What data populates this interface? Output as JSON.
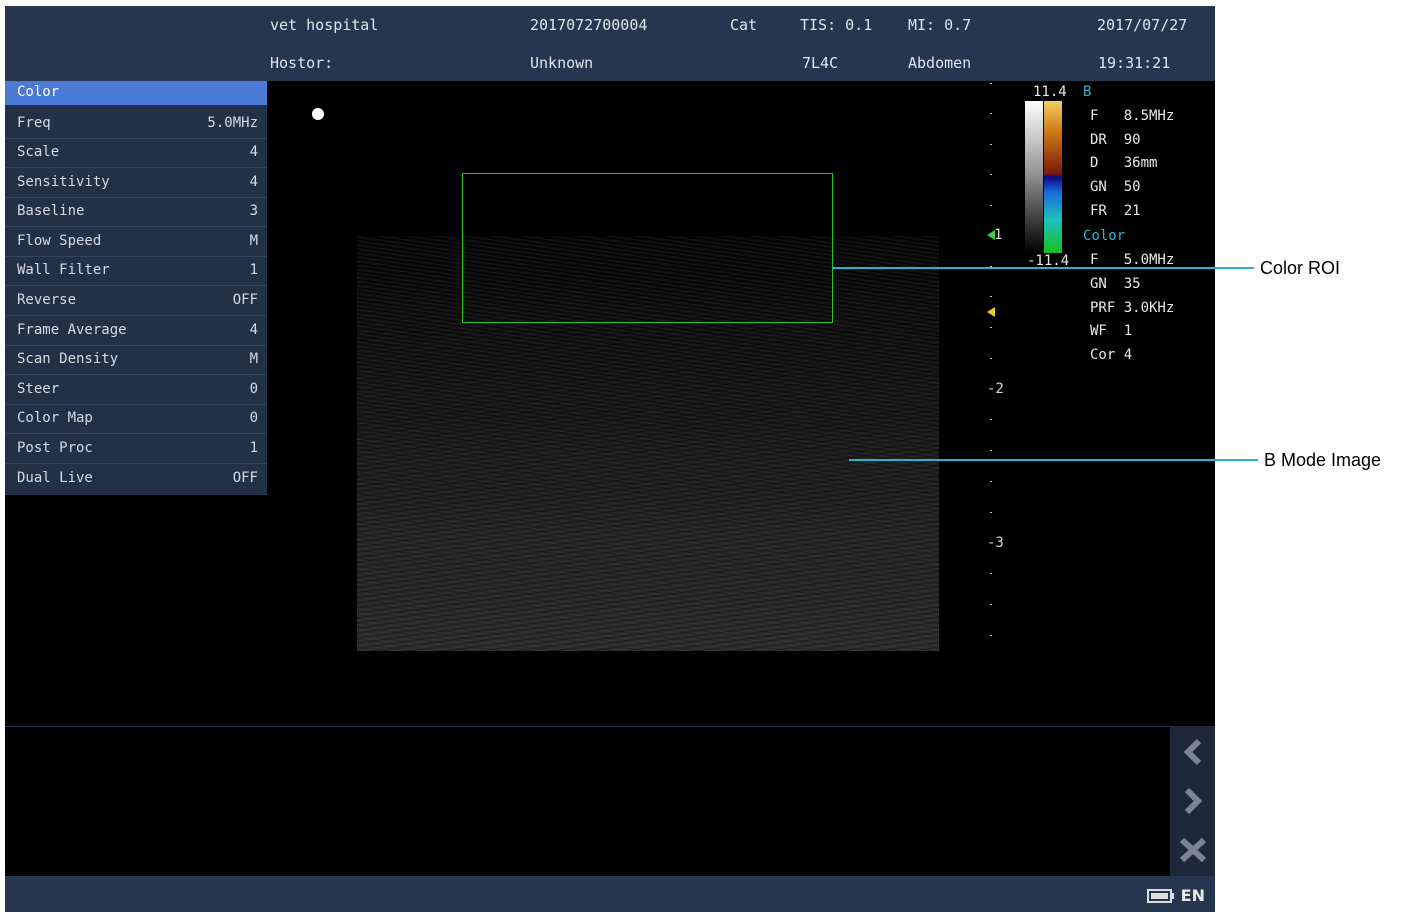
{
  "header": {
    "hospital": "vet hospital",
    "patient_id": "2017072700004",
    "species": "Cat",
    "tis": "TIS: 0.1",
    "mi": "MI: 0.7",
    "date": "2017/07/27",
    "hostor_label": "Hostor:",
    "hostor_value": "Unknown",
    "probe": "7L4C",
    "exam": "Abdomen",
    "time": "19:31:21"
  },
  "menu": {
    "title": "Color",
    "items": [
      {
        "label": "Freq",
        "value": "5.0MHz"
      },
      {
        "label": "Scale",
        "value": "4"
      },
      {
        "label": "Sensitivity",
        "value": "4"
      },
      {
        "label": "Baseline",
        "value": "3"
      },
      {
        "label": "Flow Speed",
        "value": "M"
      },
      {
        "label": "Wall Filter",
        "value": "1"
      },
      {
        "label": "Reverse",
        "value": "OFF"
      },
      {
        "label": "Frame Average",
        "value": "4"
      },
      {
        "label": "Scan Density",
        "value": "M"
      },
      {
        "label": "Steer",
        "value": "0"
      },
      {
        "label": "Color Map",
        "value": "0"
      },
      {
        "label": "Post Proc",
        "value": "1"
      },
      {
        "label": "Dual Live",
        "value": "OFF"
      }
    ]
  },
  "depth_scale": {
    "mark1": "1",
    "mark2": "-2",
    "mark3": "-3"
  },
  "colorbar": {
    "max": "11.4",
    "min": "-11.4"
  },
  "params": {
    "b_title": "B",
    "b_f": "F   8.5MHz",
    "b_dr": "DR  90",
    "b_d": "D   36mm",
    "b_gn": "GN  50",
    "b_fr": "FR  21",
    "c_title": "Color",
    "c_f": "F   5.0MHz",
    "c_gn": "GN  35",
    "c_prf": "PRF 3.0KHz",
    "c_wf": "WF  1",
    "c_cor": "Cor 4"
  },
  "status": {
    "lang": "EN"
  },
  "side_buttons": [
    {
      "icon": "chevron-left-icon"
    },
    {
      "icon": "chevron-right-icon"
    },
    {
      "icon": "close-icon"
    }
  ],
  "callouts": {
    "color_roi": "Color ROI",
    "b_mode_image": "B Mode Image"
  },
  "colors": {
    "header_bg": "#27364f",
    "menu_sel": "#4a79d6",
    "roi_border": "#26c326",
    "callout_line": "#24b5cc"
  }
}
